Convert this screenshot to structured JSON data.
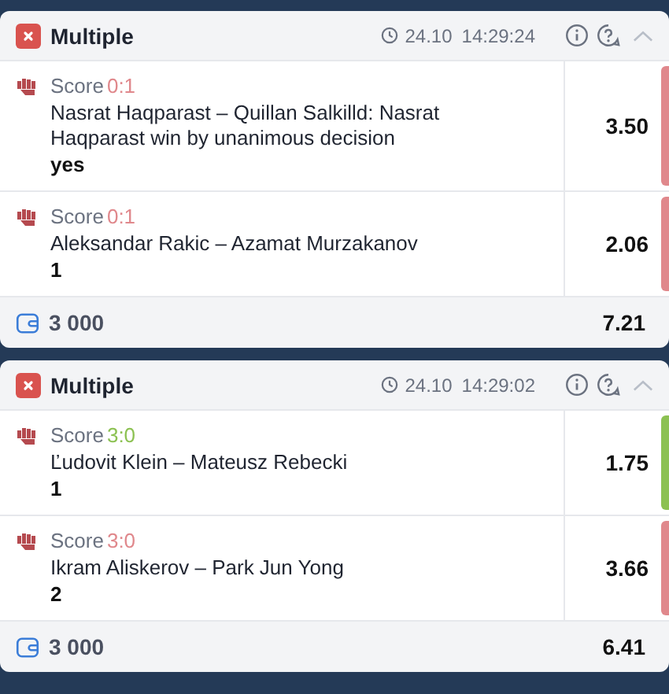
{
  "bets": [
    {
      "title": "Multiple",
      "date": "24.10",
      "time": "14:29:24",
      "stake": "3 000",
      "total_odds": "7.21",
      "selections": [
        {
          "score_label": "Score",
          "score": "0:1",
          "color": "#e0888c",
          "event": "Nasrat Haqparast – Quillan Salkilld: Nasrat Haqparast win by unanimous decision",
          "pick": "yes",
          "odds": "3.50"
        },
        {
          "score_label": "Score",
          "score": "0:1",
          "color": "#e0888c",
          "event": "Aleksandar Rakic – Azamat Murzakanov",
          "pick": "1",
          "odds": "2.06"
        }
      ]
    },
    {
      "title": "Multiple",
      "date": "24.10",
      "time": "14:29:02",
      "stake": "3 000",
      "total_odds": "6.41",
      "selections": [
        {
          "score_label": "Score",
          "score": "3:0",
          "color": "#8cc152",
          "event": "Ľudovit Klein – Mateusz Rebecki",
          "pick": "1",
          "odds": "1.75"
        },
        {
          "score_label": "Score",
          "score": "3:0",
          "color": "#e0888c",
          "event": "Ikram Aliskerov – Park Jun Yong",
          "pick": "2",
          "odds": "3.66"
        }
      ]
    }
  ]
}
